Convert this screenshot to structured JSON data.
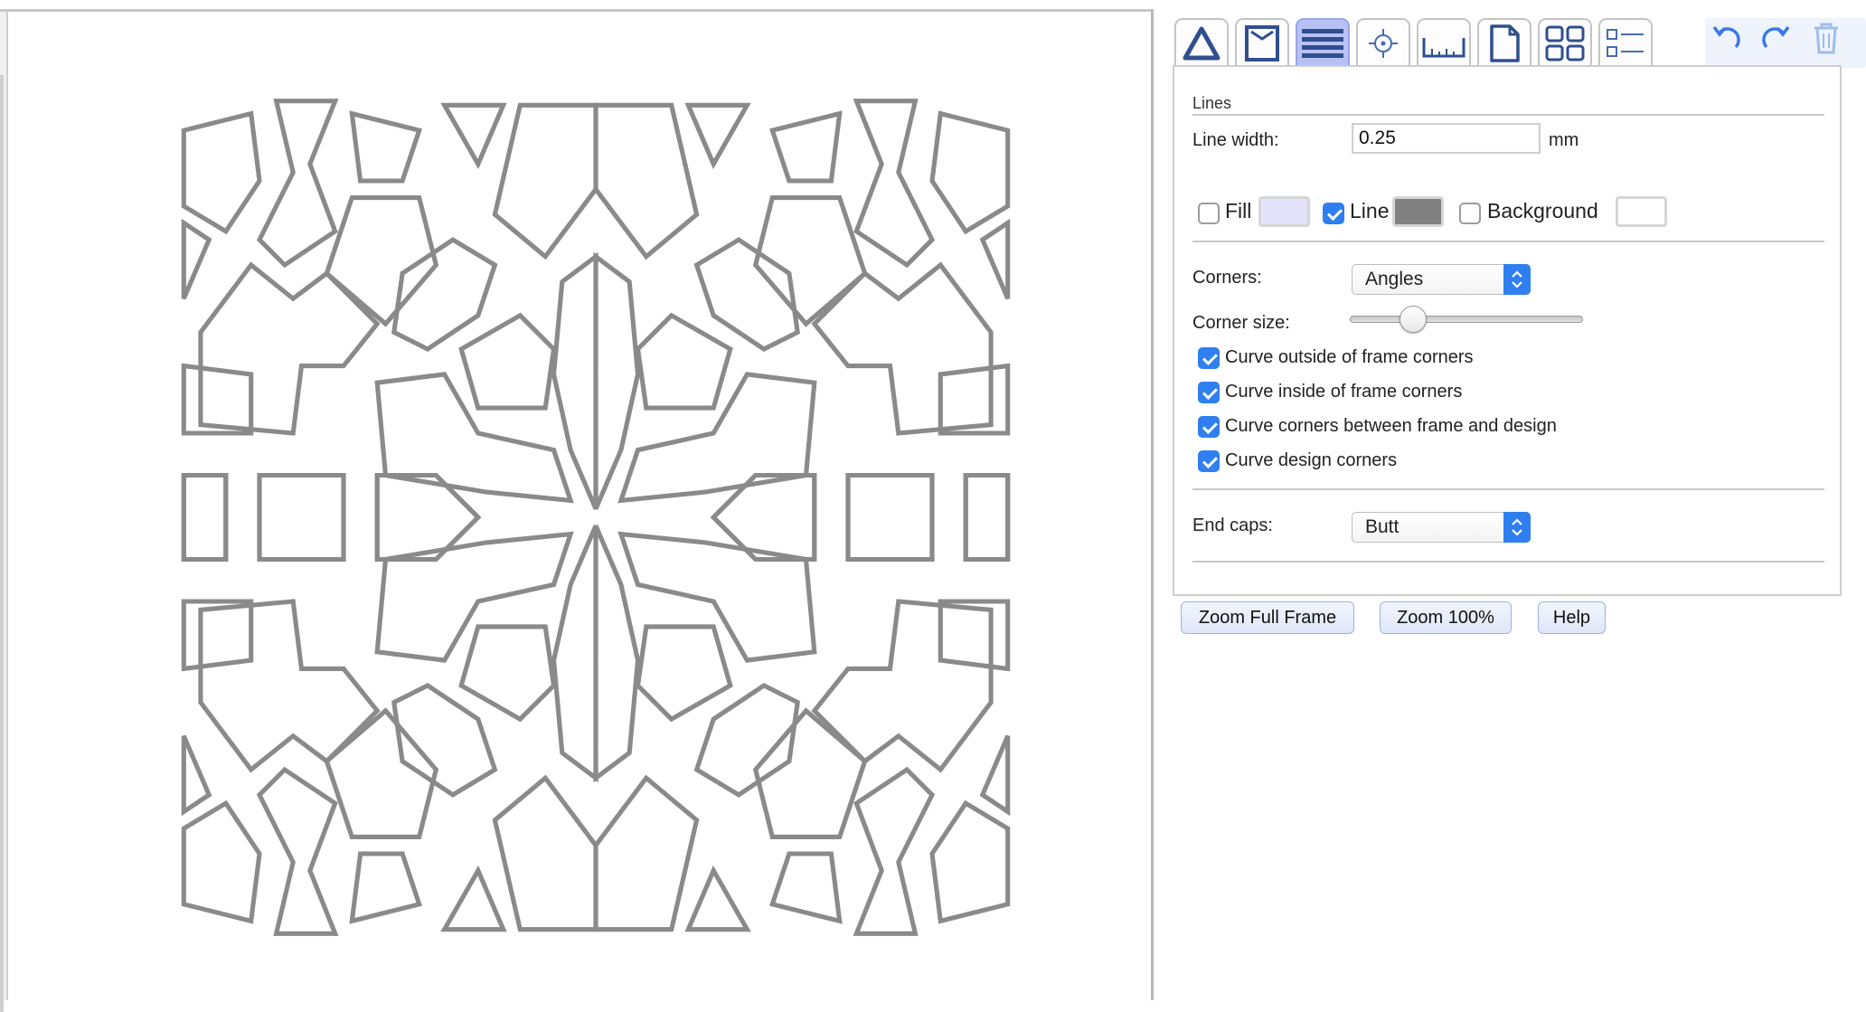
{
  "toolbar": {
    "tabs": [
      {
        "name": "shape-tab",
        "icon": "triangle-icon"
      },
      {
        "name": "frame-tab",
        "icon": "frame-icon"
      },
      {
        "name": "lines-tab",
        "icon": "lines-icon",
        "active": true
      },
      {
        "name": "center-tab",
        "icon": "crosshair-icon"
      },
      {
        "name": "ruler-tab",
        "icon": "ruler-icon"
      },
      {
        "name": "page-tab",
        "icon": "page-icon"
      },
      {
        "name": "grid-tab",
        "icon": "grid-icon"
      },
      {
        "name": "list-tab",
        "icon": "checklist-icon"
      }
    ],
    "actions": [
      "undo-icon",
      "redo-icon",
      "trash-icon"
    ],
    "active_tab_color": "#b8c1f4"
  },
  "lines_panel": {
    "section_title": "Lines",
    "line_width_label": "Line width:",
    "line_width_value": "0.25",
    "line_width_unit": "mm",
    "fill_label": "Fill",
    "fill_checked": false,
    "fill_color": "#e4e2fb",
    "line_label": "Line",
    "line_checked": true,
    "line_color": "#808080",
    "background_label": "Background",
    "background_checked": false,
    "background_color": "#ffffff",
    "corners_label": "Corners:",
    "corners_value": "Angles",
    "corner_size_label": "Corner size:",
    "corner_size_fraction": 0.27,
    "checkboxes": [
      {
        "label": "Curve outside of frame corners",
        "checked": true
      },
      {
        "label": "Curve inside of frame corners",
        "checked": true
      },
      {
        "label": "Curve corners between frame and design",
        "checked": true
      },
      {
        "label": "Curve design corners",
        "checked": true
      }
    ],
    "end_caps_label": "End caps:",
    "end_caps_value": "Butt"
  },
  "buttons": {
    "zoom_full_frame": "Zoom Full Frame",
    "zoom_100": "Zoom 100%",
    "help": "Help"
  },
  "colors": {
    "accent": "#2f7ff0",
    "design_line": "#8a8a8a"
  }
}
